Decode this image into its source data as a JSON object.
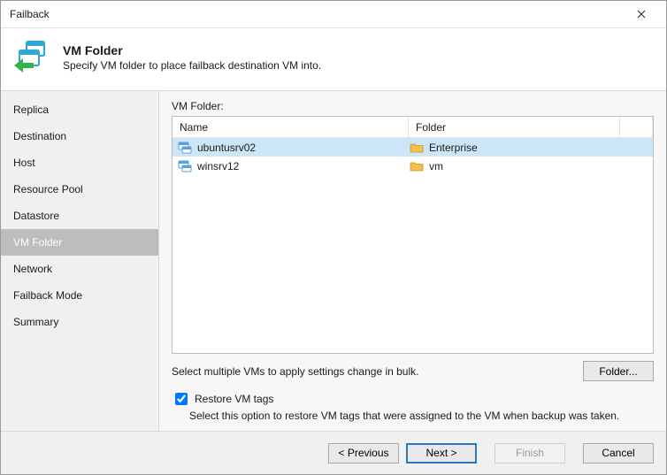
{
  "window": {
    "title": "Failback"
  },
  "header": {
    "title": "VM Folder",
    "subtitle": "Specify VM folder to place failback destination VM into."
  },
  "sidebar": {
    "items": [
      {
        "label": "Replica",
        "active": false
      },
      {
        "label": "Destination",
        "active": false
      },
      {
        "label": "Host",
        "active": false
      },
      {
        "label": "Resource Pool",
        "active": false
      },
      {
        "label": "Datastore",
        "active": false
      },
      {
        "label": "VM Folder",
        "active": true
      },
      {
        "label": "Network",
        "active": false
      },
      {
        "label": "Failback Mode",
        "active": false
      },
      {
        "label": "Summary",
        "active": false
      }
    ]
  },
  "main": {
    "list_label": "VM Folder:",
    "columns": {
      "name": "Name",
      "folder": "Folder"
    },
    "rows": [
      {
        "name": "ubuntusrv02",
        "folder": "Enterprise",
        "selected": true
      },
      {
        "name": "winsrv12",
        "folder": "vm",
        "selected": false
      }
    ],
    "bulk_hint": "Select multiple VMs to apply settings change in bulk.",
    "folder_button": "Folder...",
    "restore_tags": {
      "label": "Restore VM tags",
      "checked": true,
      "desc": "Select this option to restore VM tags that were assigned to the VM when backup was taken."
    }
  },
  "buttons": {
    "previous": "< Previous",
    "next": "Next >",
    "finish": "Finish",
    "cancel": "Cancel"
  }
}
